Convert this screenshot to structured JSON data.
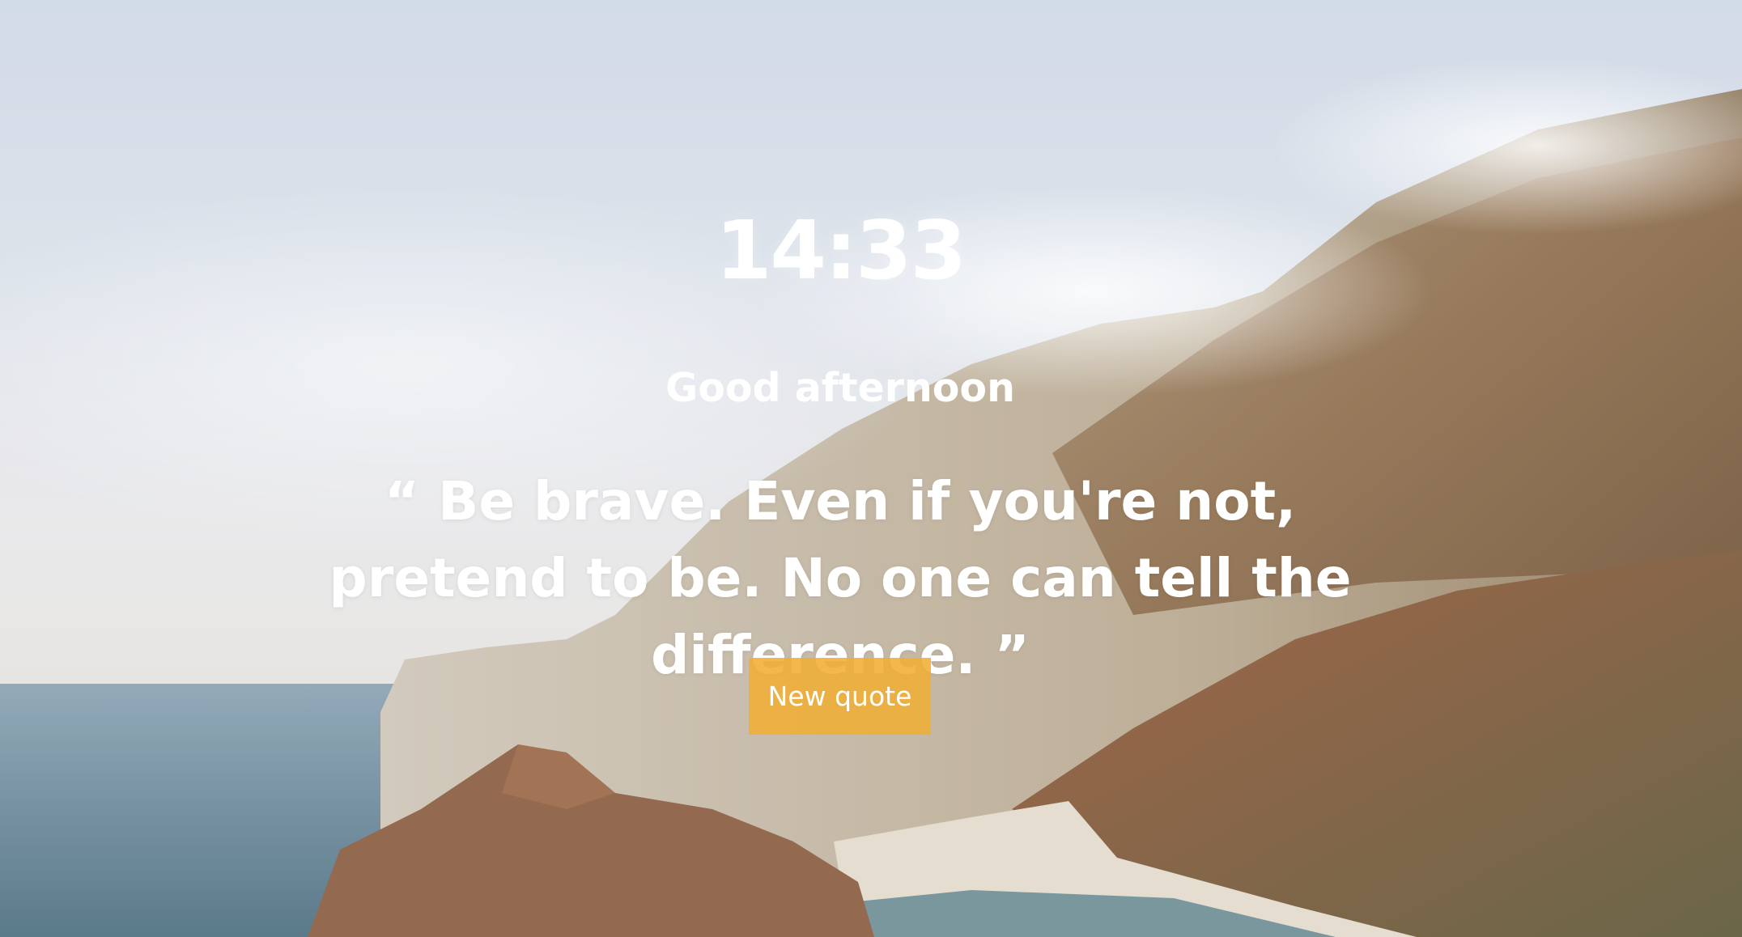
{
  "clock": {
    "time": "14:33"
  },
  "greeting": {
    "text": "Good afternoon"
  },
  "quote": {
    "open_mark": "“",
    "text": "Be brave. Even if you're not, pretend to be. No one can tell the difference.",
    "close_mark": "”"
  },
  "actions": {
    "new_quote_label": "New quote"
  },
  "colors": {
    "button_bg": "#f0ae36",
    "text": "#ffffff"
  }
}
